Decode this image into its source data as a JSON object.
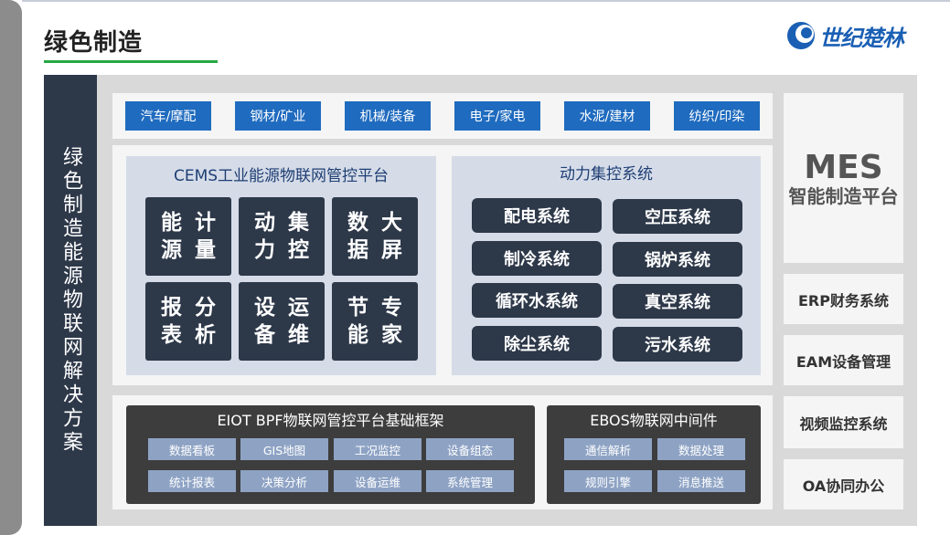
{
  "header": {
    "title": "绿色制造",
    "logo_text": "世纪楚林"
  },
  "vertical_label": "绿色制造能源物联网解决方案",
  "industries": [
    "汽车/摩配",
    "钢材/矿业",
    "机械/装备",
    "电子/家电",
    "水泥/建材",
    "纺织/印染"
  ],
  "cems": {
    "title": "CEMS工业能源物联网管控平台",
    "tiles": [
      {
        "line1": "能源",
        "line2": "计量"
      },
      {
        "line1": "动力",
        "line2": "集控"
      },
      {
        "line1": "数据",
        "line2": "大屏"
      },
      {
        "line1": "报表",
        "line2": "分析"
      },
      {
        "line1": "设备",
        "line2": "运维"
      },
      {
        "line1": "节能",
        "line2": "专家"
      }
    ]
  },
  "power": {
    "title": "动力集控系统",
    "items": [
      "配电系统",
      "空压系统",
      "制冷系统",
      "锅炉系统",
      "循环水系统",
      "真空系统",
      "除尘系统",
      "污水系统"
    ]
  },
  "eiot": {
    "title": "EIOT BPF物联网管控平台基础框架",
    "items": [
      "数据看板",
      "GIS地图",
      "工况监控",
      "设备组态",
      "统计报表",
      "决策分析",
      "设备运维",
      "系统管理"
    ]
  },
  "ebos": {
    "title": "EBOS物联网中间件",
    "items": [
      "通信解析",
      "数据处理",
      "规则引擎",
      "消息推送"
    ]
  },
  "side": {
    "mes_main": "MES",
    "mes_sub": "智能制造平台",
    "erp": "ERP财务系统",
    "eam": "EAM设备管理",
    "video": "视频监控系统",
    "oa": "OA协同办公"
  },
  "colors": {
    "accent_green": "#27a844",
    "brand_blue": "#1a5fb4",
    "industry_blue": "#1f6bbf",
    "dark_tile": "#2d3849",
    "chip": "#8ea3c4"
  }
}
